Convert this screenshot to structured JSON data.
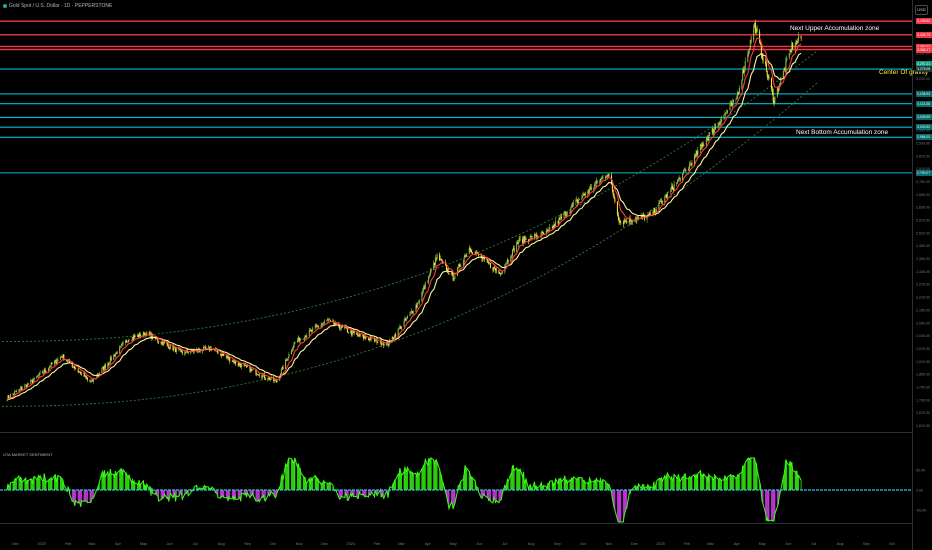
{
  "header": {
    "title": "Gold Spot / U.S. Dollar · 1D · PEPPERSTONE"
  },
  "currency_button": "USD",
  "indicator_title": "UTA MARKET SENTIMENT",
  "annotations": {
    "upper_zone": "Next Upper  Accumulation zone",
    "center": "Center Of gravity",
    "bottom_zone": "Next Bottom Accumulation zone"
  },
  "colors": {
    "background": "#000000",
    "resistance": "#f23645",
    "support": "#00bcd4",
    "ema_fast": "#ff3b3b",
    "ema_slow": "#fff59d",
    "channel": "#2e7d32",
    "candle_up": "#8bc34a",
    "candle_down": "#ffeb3b",
    "osc_pos": "#39ff14",
    "osc_neg": "#e040fb",
    "osc_zero": "#26c6da",
    "osc_neg2": "#9e9d24"
  },
  "price_tags": [
    {
      "label": "3,498.50",
      "style": "red"
    },
    {
      "label": "3,434.75",
      "style": "red"
    },
    {
      "label": "3,380.33",
      "style": "red"
    },
    {
      "label": "3,366.17",
      "style": "red"
    },
    {
      "label": "3,297.21",
      "style": "green"
    },
    {
      "label": "3,275.08",
      "style": "dark"
    },
    {
      "label": "3,158.92",
      "style": "cyan"
    },
    {
      "label": "3,113.38",
      "style": "cyan"
    },
    {
      "label": "3,048.95",
      "style": "cyan"
    },
    {
      "label": "3,003.50",
      "style": "cyan"
    },
    {
      "label": "2,956.02",
      "style": "cyan"
    },
    {
      "label": "2,790.07",
      "style": "cyan"
    }
  ],
  "chart_data": {
    "type": "candlestick",
    "price_axis_ticks": [
      "3,350.00",
      "3,290.00",
      "3,230.00",
      "3,170.00",
      "3,110.00",
      "3,050.00",
      "2,990.00",
      "2,930.00",
      "2,870.00",
      "2,810.00",
      "2,750.00",
      "2,690.00",
      "2,630.00",
      "2,570.00",
      "2,510.00",
      "2,450.00",
      "2,390.00",
      "2,330.00",
      "2,270.00",
      "2,210.00",
      "2,150.00",
      "2,090.00",
      "2,030.00",
      "1,970.00",
      "1,910.00",
      "1,850.00",
      "1,790.00",
      "1,730.00",
      "1,670.00",
      "1,610.00"
    ],
    "time_axis_ticks": [
      "Dec",
      "2023",
      "Feb",
      "Mar",
      "Apr",
      "May",
      "Jun",
      "Jul",
      "Aug",
      "Sep",
      "Oct",
      "Nov",
      "Dec",
      "2024",
      "Feb",
      "Mar",
      "Apr",
      "May",
      "Jun",
      "Jul",
      "Aug",
      "Sep",
      "Oct",
      "Nov",
      "Dec",
      "2025",
      "Feb",
      "Mar",
      "Apr",
      "May",
      "Jun",
      "Jul",
      "Aug",
      "Sep",
      "Oct"
    ],
    "indicator_axis_ticks": [
      "50.00",
      "0.00",
      "-50.00"
    ],
    "horizontal_levels": [
      {
        "price": 3498.5,
        "color": "red"
      },
      {
        "price": 3434.75,
        "color": "red"
      },
      {
        "price": 3380.33,
        "color": "red"
      },
      {
        "price": 3366.17,
        "color": "red"
      },
      {
        "price": 3275.08,
        "color": "cyan"
      },
      {
        "price": 3158.92,
        "color": "cyan"
      },
      {
        "price": 3113.38,
        "color": "cyan"
      },
      {
        "price": 3048.95,
        "color": "cyan"
      },
      {
        "price": 3003.5,
        "color": "cyan"
      },
      {
        "price": 2956.02,
        "color": "cyan"
      },
      {
        "price": 2790.07,
        "color": "cyan"
      }
    ],
    "close_path": [
      {
        "date": "2022-11-21",
        "value": 1740
      },
      {
        "date": "2022-12-20",
        "value": 1815
      },
      {
        "date": "2023-01-25",
        "value": 1935
      },
      {
        "date": "2023-02-28",
        "value": 1810
      },
      {
        "date": "2023-04-13",
        "value": 2015
      },
      {
        "date": "2023-05-04",
        "value": 2040
      },
      {
        "date": "2023-06-15",
        "value": 1950
      },
      {
        "date": "2023-07-20",
        "value": 1970
      },
      {
        "date": "2023-08-20",
        "value": 1900
      },
      {
        "date": "2023-10-05",
        "value": 1815
      },
      {
        "date": "2023-10-27",
        "value": 2000
      },
      {
        "date": "2023-12-04",
        "value": 2100
      },
      {
        "date": "2024-01-10",
        "value": 2030
      },
      {
        "date": "2024-02-14",
        "value": 1990
      },
      {
        "date": "2024-03-20",
        "value": 2180
      },
      {
        "date": "2024-04-12",
        "value": 2400
      },
      {
        "date": "2024-05-01",
        "value": 2300
      },
      {
        "date": "2024-05-20",
        "value": 2440
      },
      {
        "date": "2024-06-25",
        "value": 2320
      },
      {
        "date": "2024-07-17",
        "value": 2470
      },
      {
        "date": "2024-08-20",
        "value": 2510
      },
      {
        "date": "2024-09-25",
        "value": 2660
      },
      {
        "date": "2024-10-31",
        "value": 2790
      },
      {
        "date": "2024-11-14",
        "value": 2560
      },
      {
        "date": "2024-12-20",
        "value": 2590
      },
      {
        "date": "2025-01-31",
        "value": 2800
      },
      {
        "date": "2025-02-24",
        "value": 2950
      },
      {
        "date": "2025-03-31",
        "value": 3130
      },
      {
        "date": "2025-04-22",
        "value": 3480
      },
      {
        "date": "2025-05-15",
        "value": 3130
      },
      {
        "date": "2025-06-05",
        "value": 3380
      },
      {
        "date": "2025-06-16",
        "value": 3420
      }
    ],
    "channel": {
      "upper_start": 2003,
      "upper_end": 3360,
      "lower_start": 1700,
      "lower_end": 3210
    },
    "y_range": [
      1580,
      3560
    ],
    "indicator_range": [
      -80,
      80
    ],
    "grid": false
  }
}
